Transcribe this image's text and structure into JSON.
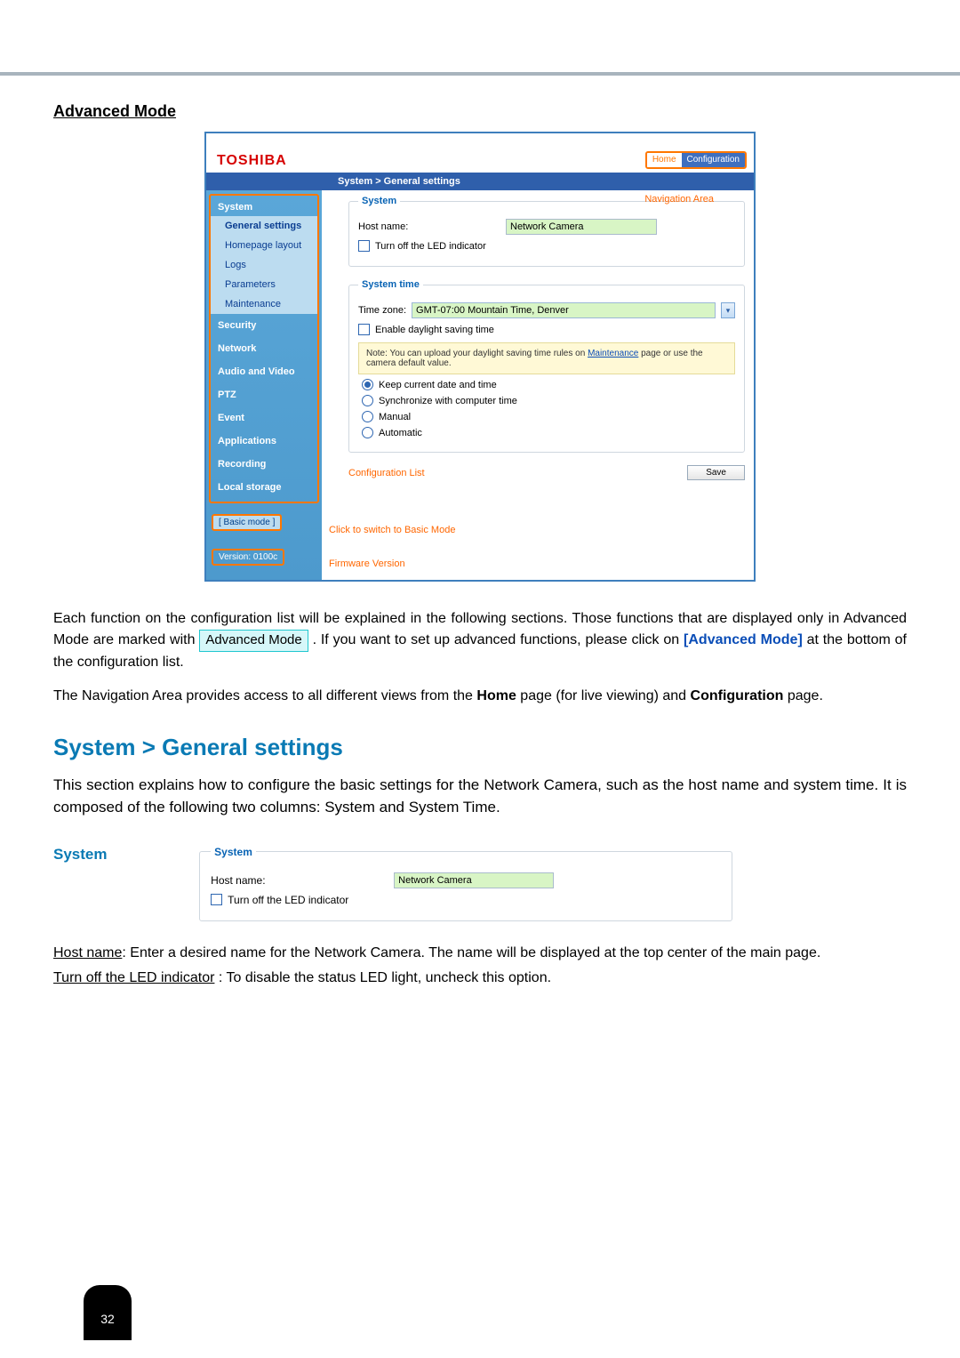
{
  "heading": "Advanced Mode",
  "brand": "TOSHIBA",
  "nav": {
    "home": "Home",
    "configuration": "Configuration"
  },
  "breadcrumb": "System  >  General settings",
  "navigation_area_label": "Navigation Area",
  "sidebar": {
    "system": "System",
    "subs": {
      "general": "General settings",
      "homepage": "Homepage layout",
      "logs": "Logs",
      "parameters": "Parameters",
      "maintenance": "Maintenance"
    },
    "items": {
      "security": "Security",
      "network": "Network",
      "av": "Audio and Video",
      "ptz": "PTZ",
      "event": "Event",
      "applications": "Applications",
      "recording": "Recording",
      "local": "Local storage"
    },
    "basic_mode": "[ Basic mode ]",
    "version": "Version: 0100c"
  },
  "system_box": {
    "legend": "System",
    "host_label": "Host name:",
    "host_value": "Network Camera",
    "led_label": "Turn off the LED indicator"
  },
  "system_time": {
    "legend": "System time",
    "tz_label": "Time zone:",
    "tz_value": "GMT-07:00 Mountain Time, Denver",
    "dst_label": "Enable daylight saving time",
    "note_a": "Note: You can upload your daylight saving time rules on ",
    "note_link": "Maintenance",
    "note_b": " page or use the camera default value.",
    "opt_keep": "Keep current date and time",
    "opt_sync": "Synchronize with computer time",
    "opt_manual": "Manual",
    "opt_auto": "Automatic"
  },
  "config_list_label": "Configuration List",
  "save_label": "Save",
  "basic_mode_note": "Click to switch to Basic Mode",
  "firmware_label": "Firmware Version",
  "para1a": "Each function on the configuration list will be explained in the following sections. Those functions that are displayed only in Advanced Mode are marked with ",
  "adv_pill": "Advanced Mode",
  "para1b": ". If you want to set up advanced functions, please click on ",
  "adv_link": "[Advanced Mode]",
  "para1c": " at the bottom of the configuration list.",
  "para2a": "The Navigation Area provides access to all different views from the ",
  "para2_home": "Home",
  "para2b": " page (for live viewing) and ",
  "para2_conf": "Configuration",
  "para2c": " page.",
  "h2": "System > General settings",
  "para3": "This section explains how to configure the basic settings for the Network Camera, such as the host name and system time. It is composed of the following two columns: System and System Time.",
  "system_section_label": "System",
  "host_desc_a": "Host name",
  "host_desc_b": ": Enter a desired name for the Network Camera. The name will be displayed at the top center of the main page.",
  "led_desc_a": "Turn off the LED indicator",
  "led_desc_b": " : To disable the status LED light, uncheck this option.",
  "page_number": "32"
}
